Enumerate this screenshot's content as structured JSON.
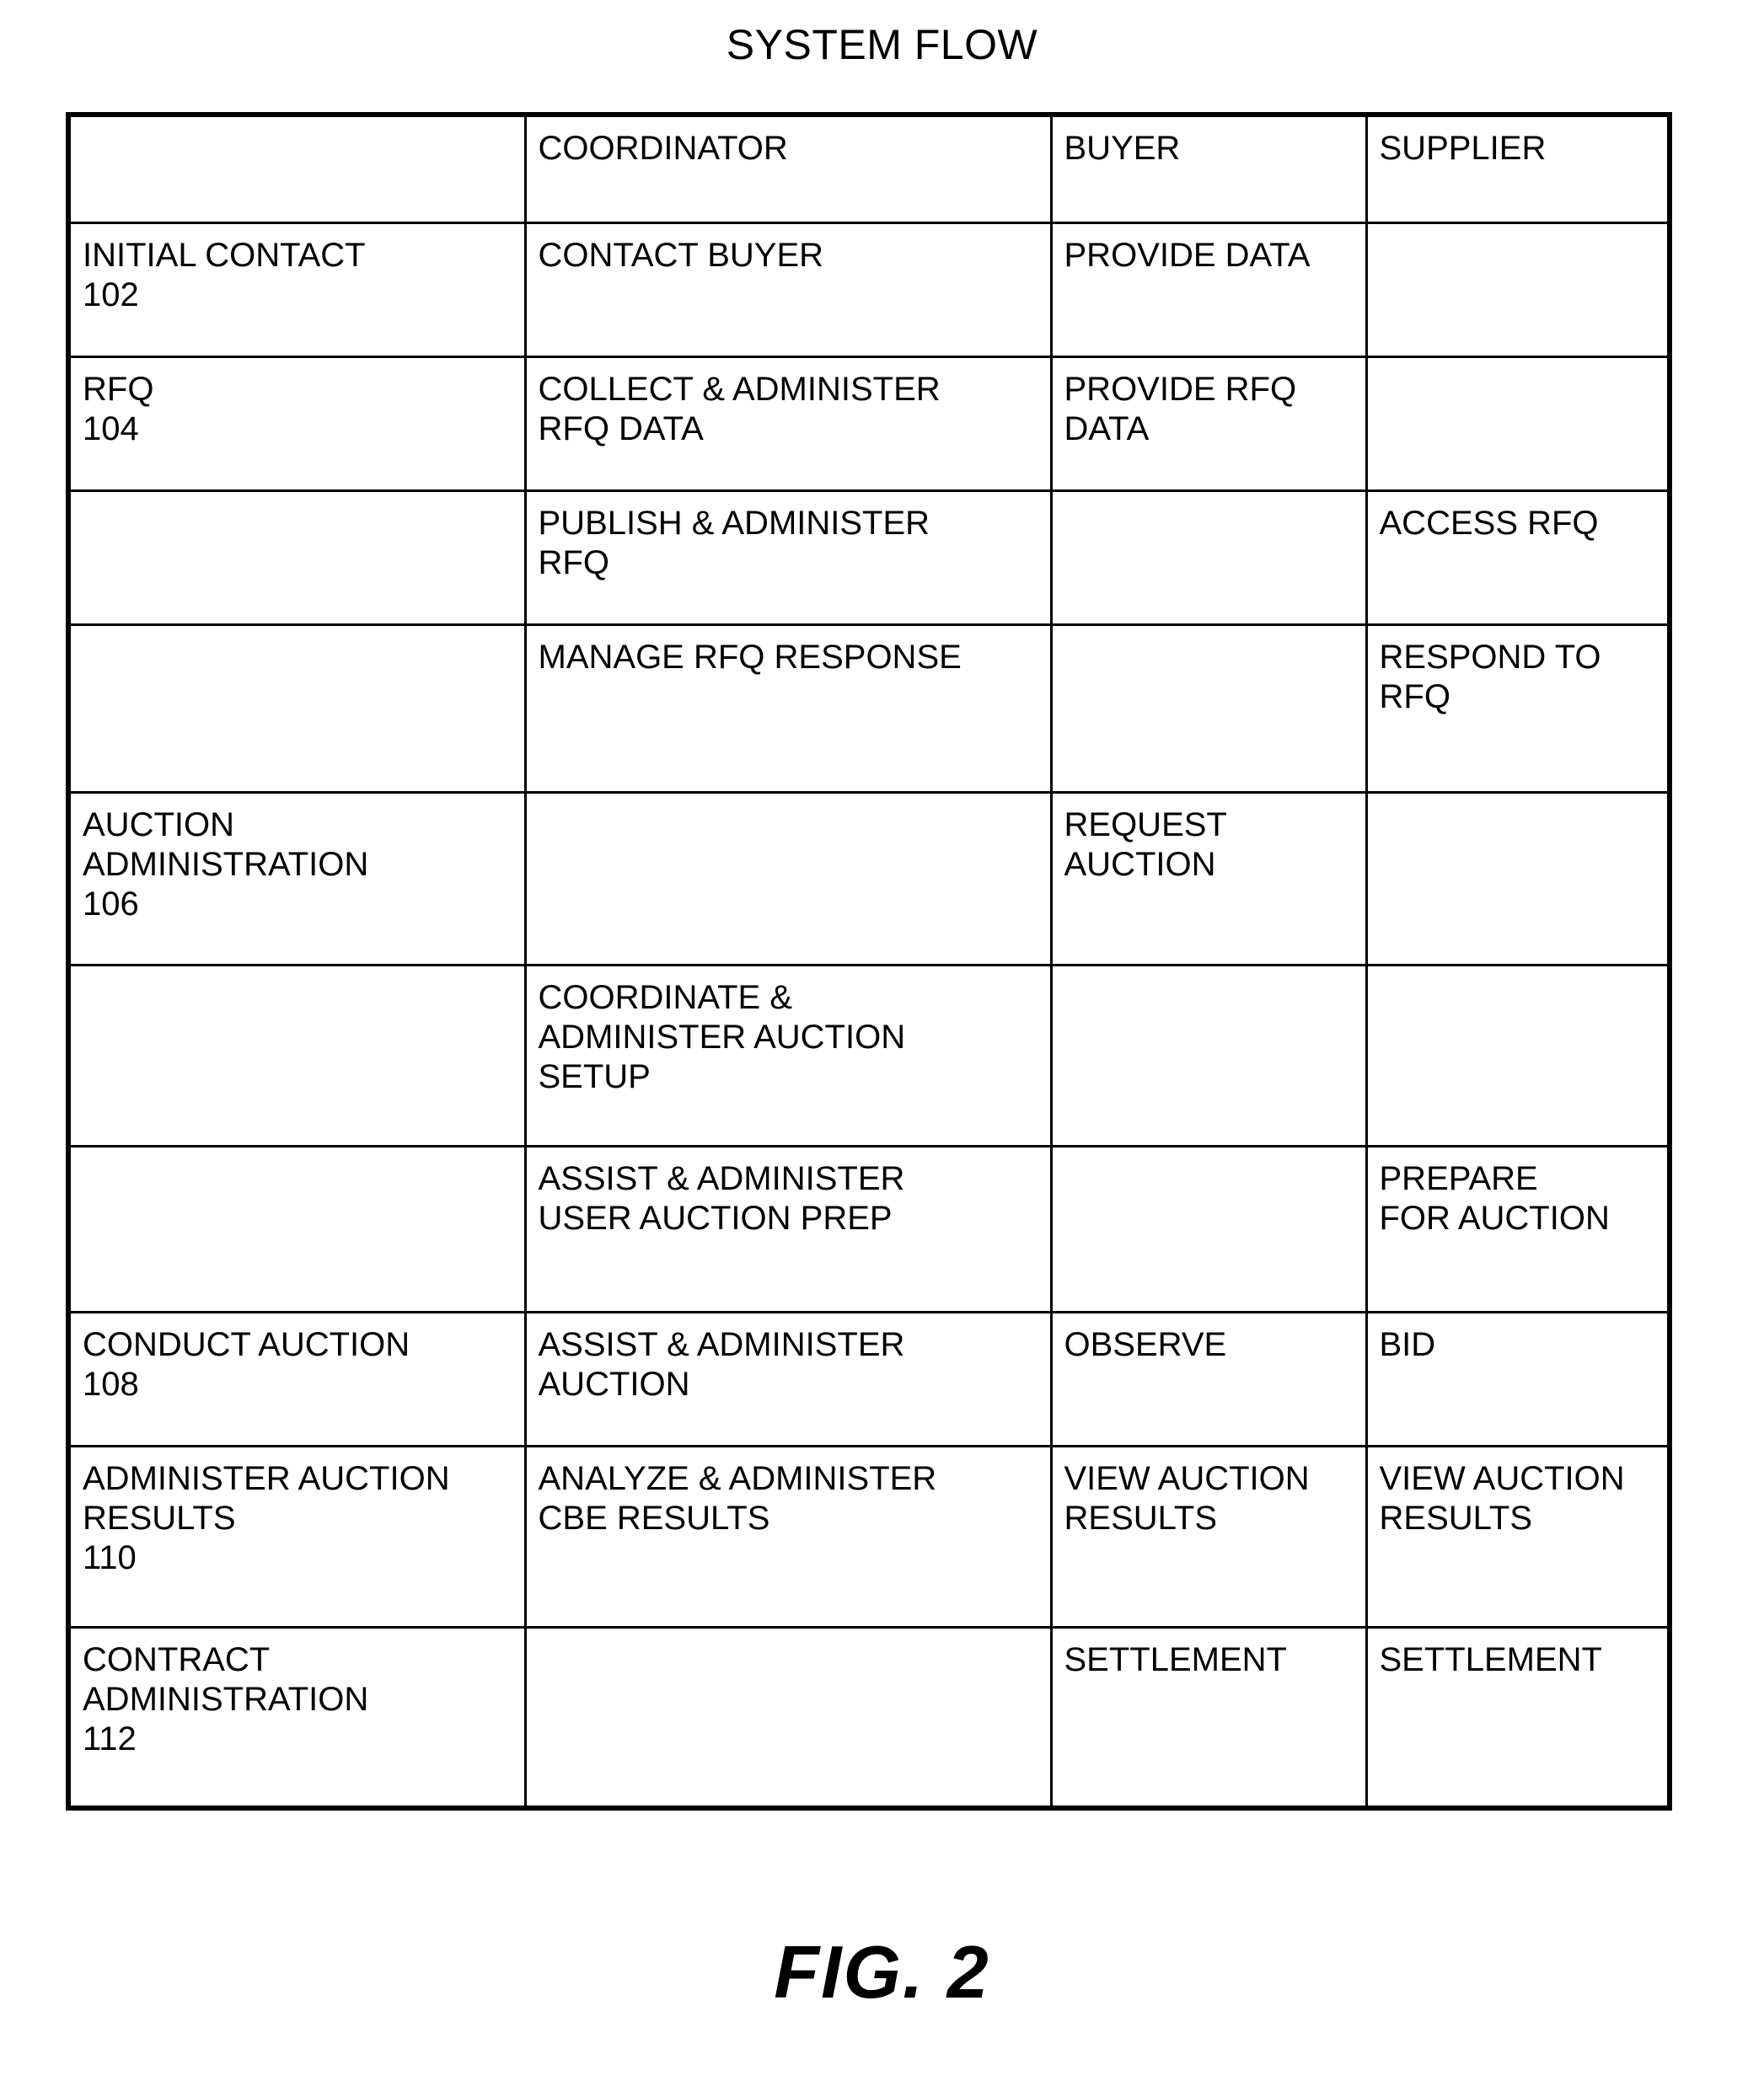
{
  "figure": {
    "title": "SYSTEM FLOW",
    "caption": "FIG. 2"
  },
  "chart_data": {
    "type": "table",
    "title": "SYSTEM FLOW",
    "columns": [
      "",
      "COORDINATOR",
      "BUYER",
      "SUPPLIER"
    ],
    "rows": [
      {
        "phase": "INITIAL CONTACT\n102",
        "coordinator": "CONTACT BUYER",
        "buyer": "PROVIDE DATA",
        "supplier": ""
      },
      {
        "phase": "RFQ\n104",
        "coordinator": "COLLECT & ADMINISTER\nRFQ DATA",
        "buyer": "PROVIDE RFQ\nDATA",
        "supplier": ""
      },
      {
        "phase": "",
        "coordinator": "PUBLISH & ADMINISTER\nRFQ",
        "buyer": "",
        "supplier": "ACCESS RFQ"
      },
      {
        "phase": "",
        "coordinator": "MANAGE RFQ RESPONSE",
        "buyer": "",
        "supplier": "RESPOND TO\nRFQ"
      },
      {
        "phase": "AUCTION\nADMINISTRATION\n106",
        "coordinator": "",
        "buyer": "REQUEST\nAUCTION",
        "supplier": ""
      },
      {
        "phase": "",
        "coordinator": "COORDINATE &\nADMINISTER AUCTION\nSETUP",
        "buyer": "",
        "supplier": ""
      },
      {
        "phase": "",
        "coordinator": "ASSIST & ADMINISTER\nUSER AUCTION PREP",
        "buyer": "",
        "supplier": "PREPARE\nFOR AUCTION"
      },
      {
        "phase": "CONDUCT AUCTION\n108",
        "coordinator": "ASSIST & ADMINISTER\nAUCTION",
        "buyer": "OBSERVE",
        "supplier": "BID"
      },
      {
        "phase": "ADMINISTER AUCTION\nRESULTS\n110",
        "coordinator": "ANALYZE & ADMINISTER\nCBE RESULTS",
        "buyer": "VIEW AUCTION\nRESULTS",
        "supplier": "VIEW AUCTION\nRESULTS"
      },
      {
        "phase": "CONTRACT\nADMINISTRATION\n112",
        "coordinator": "",
        "buyer": "SETTLEMENT",
        "supplier": "SETTLEMENT"
      }
    ],
    "reference_numerals": [
      "102",
      "104",
      "106",
      "108",
      "110",
      "112"
    ],
    "grid": true,
    "legend": "none"
  }
}
